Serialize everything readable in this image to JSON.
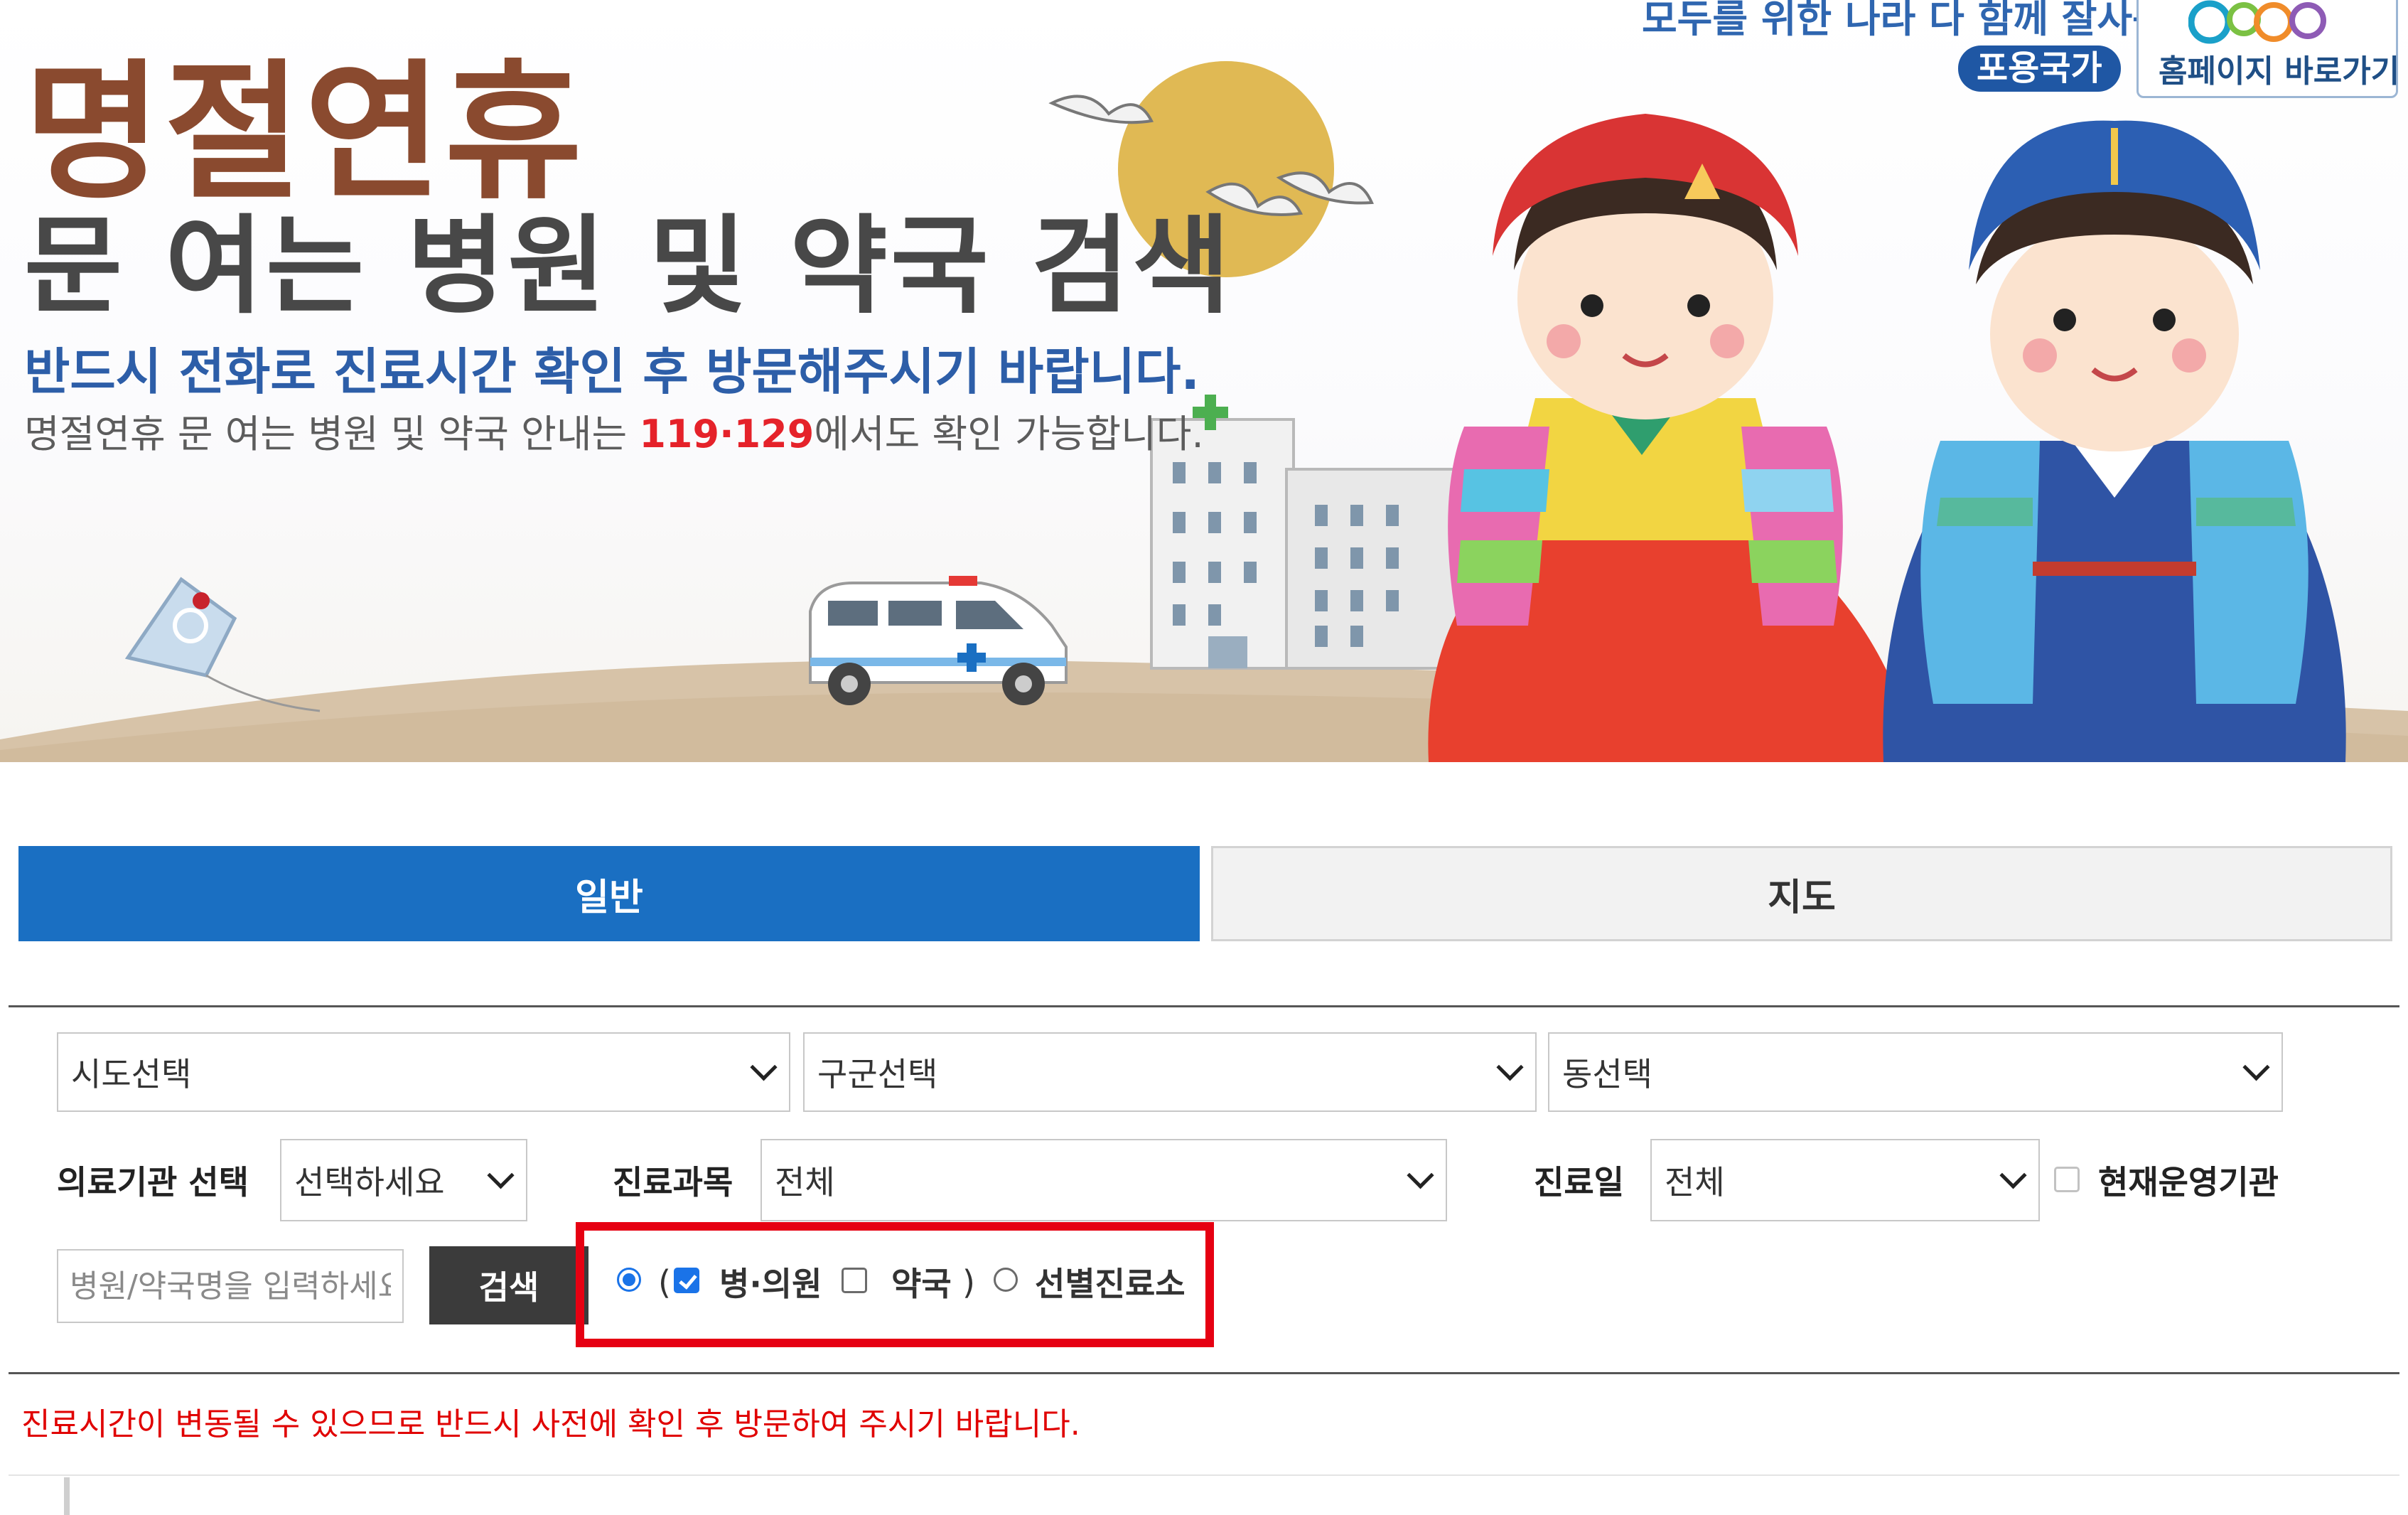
{
  "banner": {
    "title": "명절연휴",
    "subtitle": "문 여는 병원 및 약국 검색",
    "notice": "반드시 전화로 진료시간 확인 후 방문해주시기 바랍니다.",
    "info_prefix": "명절연휴 문 여는 병원 및 약국 안내는 ",
    "info_highlight": "119·129",
    "info_suffix": "에서도 확인 가능합니다.",
    "slogan": "모두를 위한 나라 다 함께 잘사는",
    "badge": "포용국가",
    "home_link_label": "홈페이지 바로가기",
    "colors": {
      "title": "#8a4a2f",
      "notice": "#2d5ea8",
      "highlight": "#e5222a",
      "badge": "#1f57a4"
    }
  },
  "tabs": [
    {
      "label": "일반",
      "active": true
    },
    {
      "label": "지도",
      "active": false
    }
  ],
  "search": {
    "sido_select": "시도선택",
    "gugun_select": "구군선택",
    "dong_select": "동선택",
    "institution_label": "의료기관 선택",
    "institution_select": "선택하세요",
    "department_label": "진료과목",
    "department_select": "전체",
    "date_label": "진료일",
    "date_select": "전체",
    "operating_label": "현재운영기관",
    "operating_checked": false,
    "name_placeholder": "병원/약국명을 입력하세요",
    "search_button": "검색",
    "type_options": {
      "open_paren": "(",
      "hospital_label": "병·의원",
      "hospital_checked": true,
      "pharmacy_label": "약국",
      "pharmacy_checked": false,
      "close_paren": ")",
      "screening_label": "선별진료소",
      "group_radio_selected": true,
      "screening_radio_selected": false
    }
  },
  "warning_text": "진료시간이 변동될 수 있으므로 반드시 사전에 확인 후 방문하여 주시기 바랍니다.",
  "theme": {
    "accent": "#1a6fc2",
    "highlight_box": "#e60012",
    "warning": "#e00000",
    "button": "#3b3b3b"
  }
}
